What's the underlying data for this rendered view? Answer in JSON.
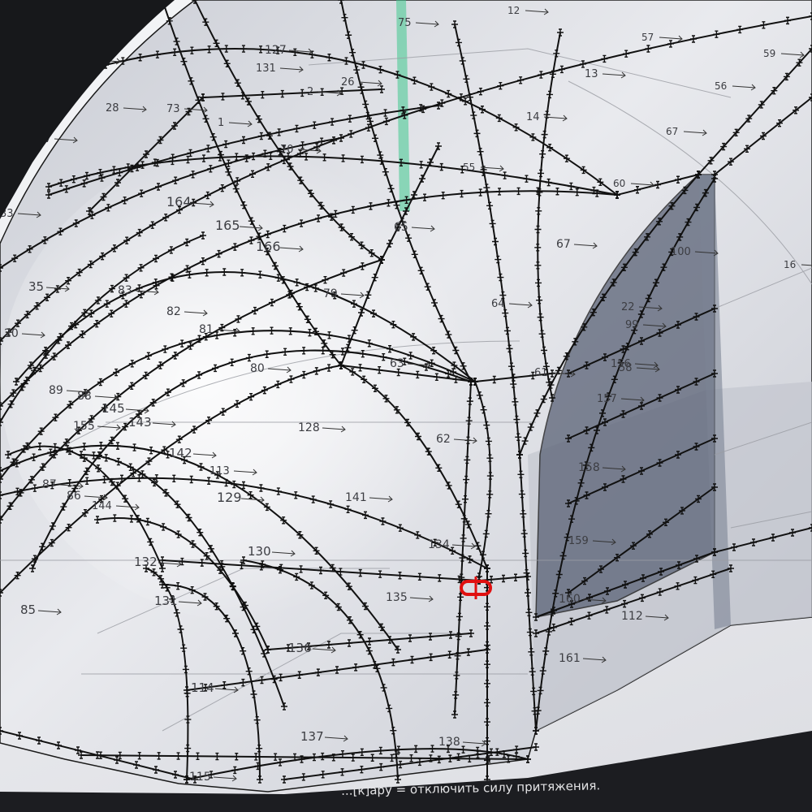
{
  "viewport": {
    "background": "#eceef1",
    "panel_tint": "#5a6276",
    "wire_color": "#111111",
    "selection_color": "#e01010"
  },
  "panel_labels": [
    "121",
    "127",
    "131",
    "2",
    "26",
    "75",
    "12",
    "57",
    "59",
    "13",
    "56",
    "77",
    "73",
    "1",
    "28",
    "14",
    "67",
    "70",
    "55",
    "60",
    "33",
    "164",
    "165",
    "166",
    "65",
    "67",
    "100",
    "16",
    "35",
    "83",
    "79",
    "64",
    "22",
    "99",
    "20",
    "82",
    "81",
    "80",
    "63",
    "61",
    "156",
    "58",
    "157",
    "89",
    "88",
    "145",
    "143",
    "128",
    "62",
    "158",
    "155",
    "142",
    "113",
    "87",
    "86",
    "144",
    "129",
    "141",
    "134",
    "159",
    "132",
    "130",
    "135",
    "160",
    "112",
    "85",
    "131",
    "136",
    "161",
    "114",
    "137",
    "138",
    "115"
  ],
  "status_bar": {
    "text": "...[к]ару = отключить силу притяжения."
  }
}
